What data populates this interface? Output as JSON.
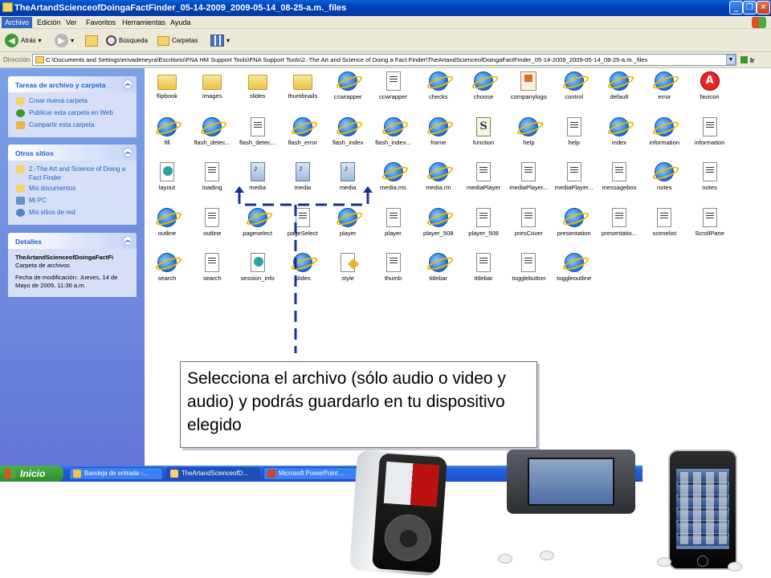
{
  "window": {
    "title": "TheArtandScienceofDoingaFactFinder_05-14-2009_2009-05-14_08-25-a.m._files"
  },
  "menu": [
    "Archivo",
    "Edición",
    "Ver",
    "Favoritos",
    "Herramientas",
    "Ayuda"
  ],
  "toolbar": {
    "back": "Atrás",
    "search": "Búsqueda",
    "folders": "Carpetas"
  },
  "address": {
    "label": "Dirección",
    "value": "C:\\Documents and Settings\\erivadeneyra\\Escritorio\\FNA HM Support Tools\\FNA Support Tools\\2.-The Art and Science of Doing a Fact Finder\\TheArtandScienceofDoingaFactFinder_05-14-2009_2009-05-14_08-25-a.m._files",
    "go": "Ir"
  },
  "left": {
    "tasks": {
      "title": "Tareas de archivo y carpeta",
      "items": [
        "Crear nueva carpeta",
        "Publicar esta carpeta en Web",
        "Compartir esta carpeta"
      ]
    },
    "places": {
      "title": "Otros sitios",
      "items": [
        "2.-The Art and Science of Doing a Fact Finder",
        "Mis documentos",
        "Mi PC",
        "Mis sitios de red"
      ]
    },
    "details": {
      "title": "Detalles",
      "name": "TheArtandScienceofDoingaFactFi",
      "type": "Carpeta de archivos",
      "modified": "Fecha de modificación: Jueves, 14 de Mayo de 2009, 11:36 a.m."
    }
  },
  "files": [
    {
      "name": "flipbook",
      "kind": "folder"
    },
    {
      "name": "images",
      "kind": "folder"
    },
    {
      "name": "slides",
      "kind": "folder"
    },
    {
      "name": "thumbnails",
      "kind": "folder"
    },
    {
      "name": "ccwrapper",
      "kind": "ie"
    },
    {
      "name": "ccwrapper",
      "kind": "doc"
    },
    {
      "name": "checks",
      "kind": "ie"
    },
    {
      "name": "choose",
      "kind": "ie"
    },
    {
      "name": "companylogo",
      "kind": "logo"
    },
    {
      "name": "control",
      "kind": "ie"
    },
    {
      "name": "default",
      "kind": "ie"
    },
    {
      "name": "error",
      "kind": "ie"
    },
    {
      "name": "favicon",
      "kind": "red"
    },
    {
      "name": "fill",
      "kind": "ie"
    },
    {
      "name": "flash_detec...",
      "kind": "ie"
    },
    {
      "name": "flash_detec...",
      "kind": "doc"
    },
    {
      "name": "flash_error",
      "kind": "ie"
    },
    {
      "name": "flash_index",
      "kind": "ie"
    },
    {
      "name": "flash_index...",
      "kind": "ie"
    },
    {
      "name": "frame",
      "kind": "ie"
    },
    {
      "name": "function",
      "kind": "swf"
    },
    {
      "name": "help",
      "kind": "ie"
    },
    {
      "name": "help",
      "kind": "doc"
    },
    {
      "name": "index",
      "kind": "ie"
    },
    {
      "name": "information",
      "kind": "ie"
    },
    {
      "name": "information",
      "kind": "doc"
    },
    {
      "name": "layout",
      "kind": "gear"
    },
    {
      "name": "loading",
      "kind": "doc"
    },
    {
      "name": "media",
      "kind": "media"
    },
    {
      "name": "media",
      "kind": "media"
    },
    {
      "name": "media",
      "kind": "media"
    },
    {
      "name": "media.ms",
      "kind": "ie"
    },
    {
      "name": "media.rm",
      "kind": "ie"
    },
    {
      "name": "mediaPlayer",
      "kind": "doc"
    },
    {
      "name": "mediaPlayer...",
      "kind": "doc"
    },
    {
      "name": "mediaPlayer...",
      "kind": "doc"
    },
    {
      "name": "messagebox",
      "kind": "doc"
    },
    {
      "name": "notes",
      "kind": "ie"
    },
    {
      "name": "notes",
      "kind": "doc"
    },
    {
      "name": "outline",
      "kind": "ie"
    },
    {
      "name": "outline",
      "kind": "doc"
    },
    {
      "name": "pageselect",
      "kind": "ie"
    },
    {
      "name": "pageSelect",
      "kind": "doc"
    },
    {
      "name": "player",
      "kind": "ie"
    },
    {
      "name": "player",
      "kind": "doc"
    },
    {
      "name": "player_508",
      "kind": "ie"
    },
    {
      "name": "player_508",
      "kind": "doc"
    },
    {
      "name": "presCover",
      "kind": "doc"
    },
    {
      "name": "presentation",
      "kind": "ie"
    },
    {
      "name": "presentatio...",
      "kind": "doc"
    },
    {
      "name": "scenelist",
      "kind": "doc"
    },
    {
      "name": "ScrollPane",
      "kind": "doc"
    },
    {
      "name": "search",
      "kind": "ie"
    },
    {
      "name": "search",
      "kind": "doc"
    },
    {
      "name": "session_info",
      "kind": "gear"
    },
    {
      "name": "slides",
      "kind": "ie"
    },
    {
      "name": "style",
      "kind": "style"
    },
    {
      "name": "thumb",
      "kind": "doc"
    },
    {
      "name": "titlebar",
      "kind": "ie"
    },
    {
      "name": "titlebar",
      "kind": "doc"
    },
    {
      "name": "togglebutton",
      "kind": "doc"
    },
    {
      "name": "toggleoutline",
      "kind": "ie"
    }
  ],
  "taskbar": {
    "start": "Inicio",
    "tasks": [
      "Bandeja de entrada -...",
      "TheArtandScienceofD...",
      "Microsoft PowerPoint ..."
    ]
  },
  "callout": "Selecciona el archivo (sólo audio o video y audio) y podrás guardarlo en tu dispositivo elegido",
  "colors": {
    "arrow": "#1a2f99",
    "xp_blue": "#0041b8",
    "taskpane": "#6375d6"
  }
}
